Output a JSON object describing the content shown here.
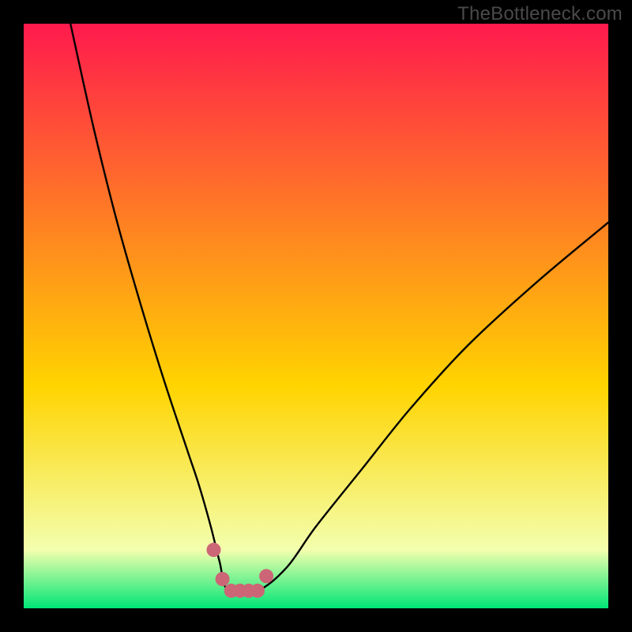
{
  "watermark": "TheBottleneck.com",
  "chart_data": {
    "type": "line",
    "title": "",
    "xlabel": "",
    "ylabel": "",
    "xlim": [
      0,
      100
    ],
    "ylim": [
      0,
      100
    ],
    "background_gradient": {
      "top": "#ff1a4d",
      "mid": "#ffd400",
      "bottom": "#00e676"
    },
    "green_band_top": 93,
    "series": [
      {
        "name": "curve",
        "color": "#000000",
        "x": [
          8,
          12,
          16,
          20,
          24,
          28,
          30,
          32,
          33.5,
          35,
          40,
          45,
          50,
          58,
          66,
          76,
          88,
          100
        ],
        "y": [
          100,
          82,
          66,
          52,
          39,
          27,
          21,
          14,
          8,
          3,
          3,
          7,
          14,
          24,
          34,
          45,
          56,
          66
        ]
      }
    ],
    "markers": {
      "name": "highlight-points",
      "color": "#cc6677",
      "radius": 9,
      "x": [
        32.5,
        34.0,
        35.5,
        37.0,
        38.5,
        40.0,
        41.5
      ],
      "y": [
        10.0,
        5.0,
        3.0,
        3.0,
        3.0,
        3.0,
        5.5
      ]
    }
  }
}
